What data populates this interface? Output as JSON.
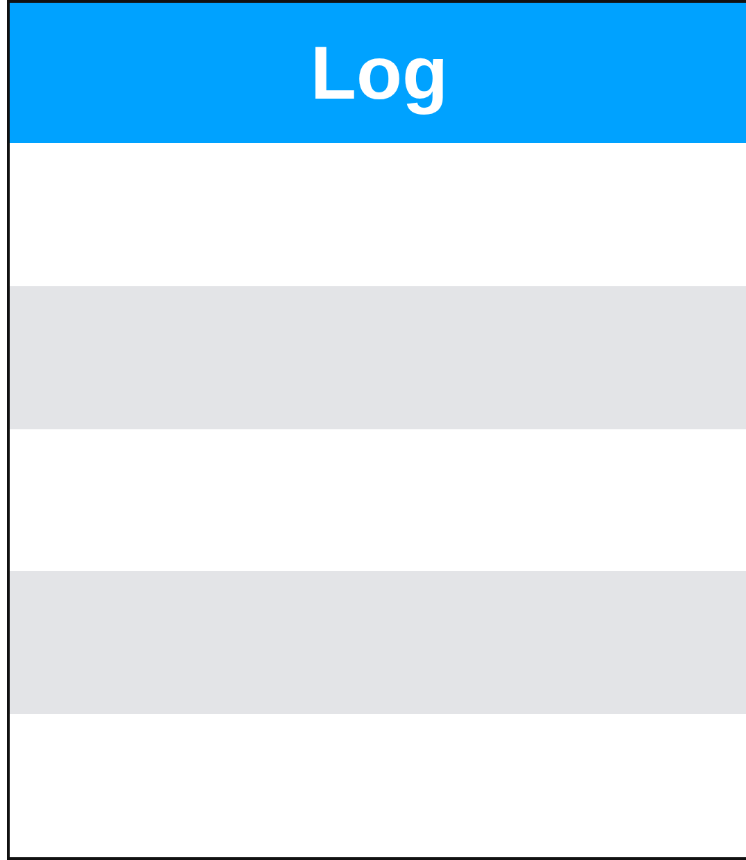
{
  "header": {
    "title": "Log"
  },
  "rows": [
    {
      "shaded": false
    },
    {
      "shaded": true
    },
    {
      "shaded": false
    },
    {
      "shaded": true
    },
    {
      "shaded": false
    }
  ]
}
